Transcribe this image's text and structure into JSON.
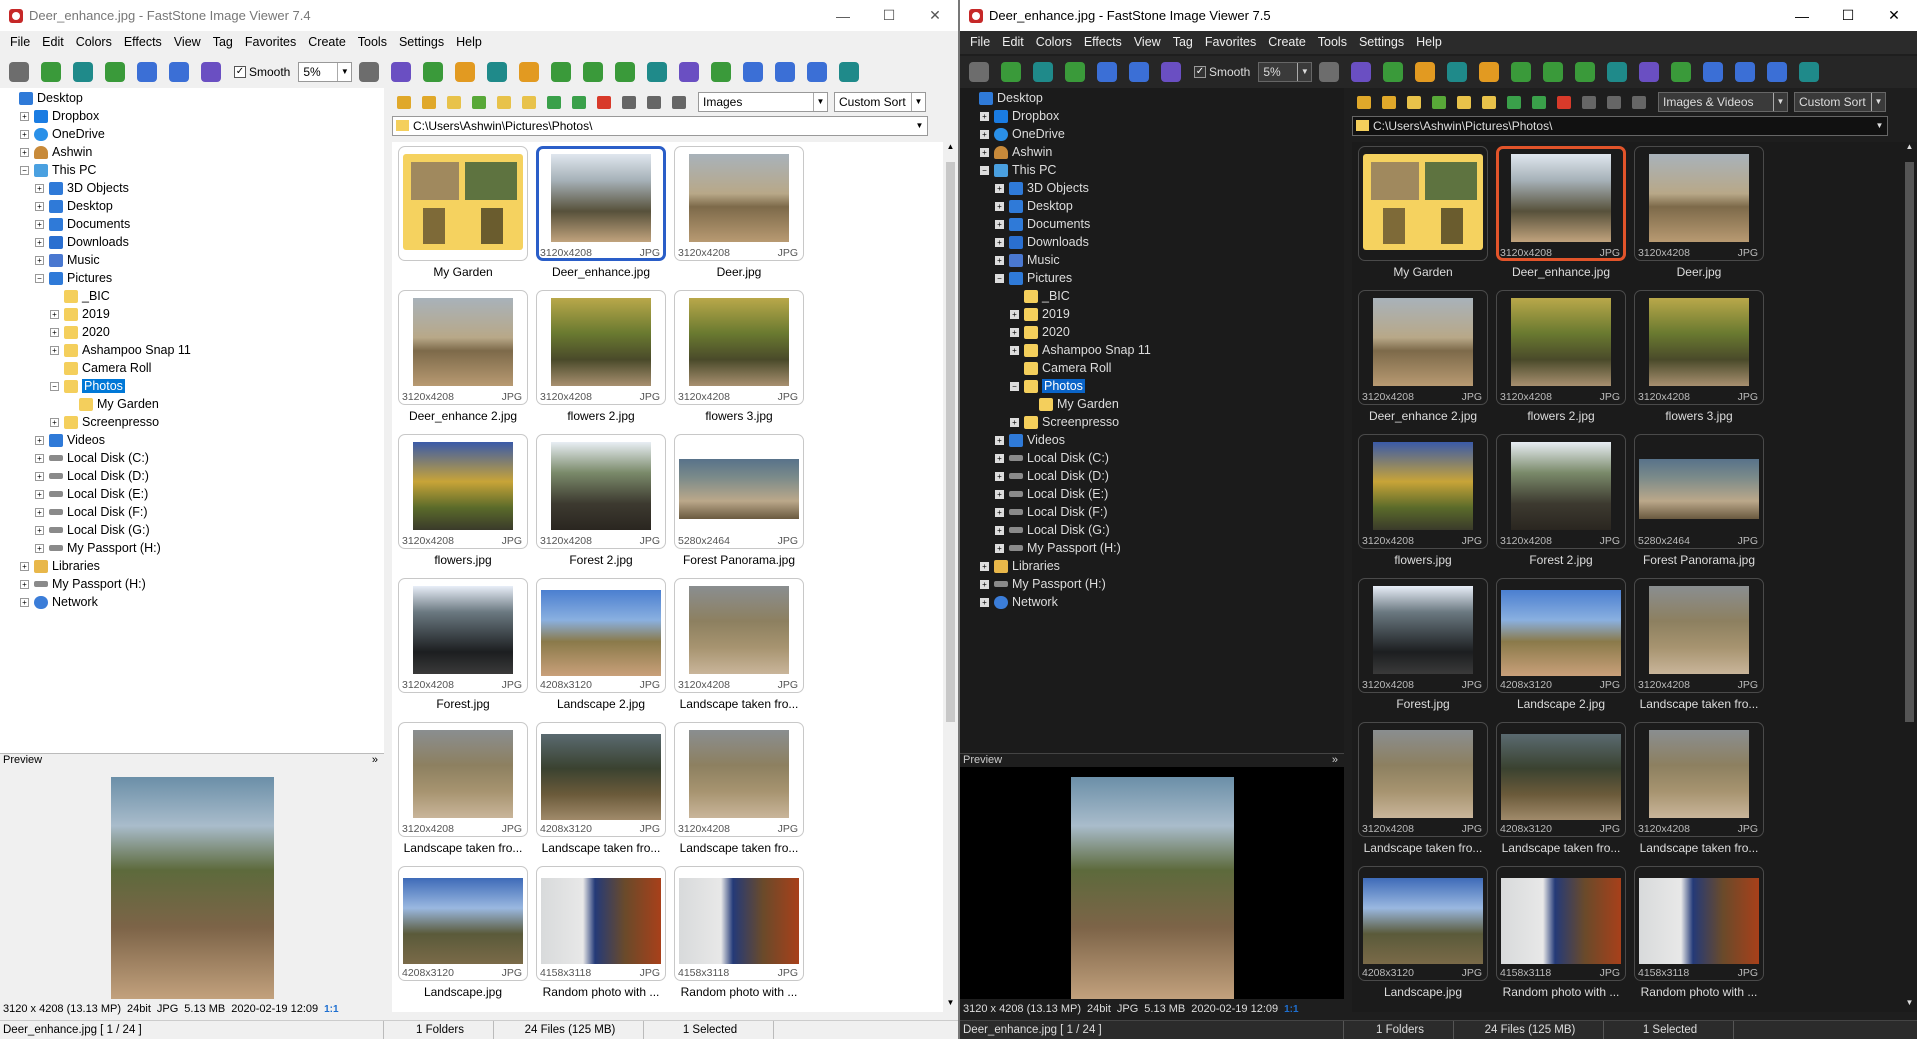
{
  "left": {
    "title": "Deer_enhance.jpg - FastStone Image Viewer 7.4",
    "menu": [
      "File",
      "Edit",
      "Colors",
      "Effects",
      "View",
      "Tag",
      "Favorites",
      "Create",
      "Tools",
      "Settings",
      "Help"
    ],
    "smooth_label": "Smooth",
    "zoom": "5%",
    "filter": "Images",
    "sort": "Custom Sort",
    "path": "C:\\Users\\Ashwin\\Pictures\\Photos\\",
    "preview_label": "Preview",
    "preview_info": {
      "dims": "3120 x 4208 (13.13 MP)",
      "bits": "24bit",
      "fmt": "JPG",
      "size": "5.13 MB",
      "date": "2020-02-19 12:09",
      "ratio": "1:1"
    },
    "status": {
      "file": "Deer_enhance.jpg [ 1 / 24 ]",
      "folders": "1 Folders",
      "files": "24 Files (125 MB)",
      "selected": "1 Selected"
    }
  },
  "right": {
    "title": "Deer_enhance.jpg - FastStone Image Viewer 7.5",
    "menu": [
      "File",
      "Edit",
      "Colors",
      "Effects",
      "View",
      "Tag",
      "Favorites",
      "Create",
      "Tools",
      "Settings",
      "Help"
    ],
    "smooth_label": "Smooth",
    "zoom": "5%",
    "filter": "Images & Videos",
    "sort": "Custom Sort",
    "path": "C:\\Users\\Ashwin\\Pictures\\Photos\\",
    "preview_label": "Preview",
    "preview_info": {
      "dims": "3120 x 4208 (13.13 MP)",
      "bits": "24bit",
      "fmt": "JPG",
      "size": "5.13 MB",
      "date": "2020-02-19 12:09",
      "ratio": "1:1"
    },
    "status": {
      "file": "Deer_enhance.jpg [ 1 / 24 ]",
      "folders": "1 Folders",
      "files": "24 Files (125 MB)",
      "selected": "1 Selected"
    }
  },
  "tree": [
    {
      "label": "Desktop",
      "icon": "blue",
      "level": 0,
      "exp": ""
    },
    {
      "label": "Dropbox",
      "icon": "dropbox",
      "level": 1,
      "exp": "+"
    },
    {
      "label": "OneDrive",
      "icon": "cloud",
      "level": 1,
      "exp": "+"
    },
    {
      "label": "Ashwin",
      "icon": "user",
      "level": 1,
      "exp": "+"
    },
    {
      "label": "This PC",
      "icon": "pc",
      "level": 1,
      "exp": "-"
    },
    {
      "label": "3D Objects",
      "icon": "blue",
      "level": 2,
      "exp": "+"
    },
    {
      "label": "Desktop",
      "icon": "blue",
      "level": 2,
      "exp": "+"
    },
    {
      "label": "Documents",
      "icon": "blue",
      "level": 2,
      "exp": "+"
    },
    {
      "label": "Downloads",
      "icon": "down",
      "level": 2,
      "exp": "+"
    },
    {
      "label": "Music",
      "icon": "music",
      "level": 2,
      "exp": "+"
    },
    {
      "label": "Pictures",
      "icon": "blue",
      "level": 2,
      "exp": "-"
    },
    {
      "label": "_BIC",
      "icon": "folder",
      "level": 3,
      "exp": ""
    },
    {
      "label": "2019",
      "icon": "folder",
      "level": 3,
      "exp": "+"
    },
    {
      "label": "2020",
      "icon": "folder",
      "level": 3,
      "exp": "+"
    },
    {
      "label": "Ashampoo Snap 11",
      "icon": "folder",
      "level": 3,
      "exp": "+"
    },
    {
      "label": "Camera Roll",
      "icon": "folder",
      "level": 3,
      "exp": ""
    },
    {
      "label": "Photos",
      "icon": "folder",
      "level": 3,
      "exp": "-",
      "selected": true
    },
    {
      "label": "My Garden",
      "icon": "folder",
      "level": 4,
      "exp": ""
    },
    {
      "label": "Screenpresso",
      "icon": "folder",
      "level": 3,
      "exp": "+"
    },
    {
      "label": "Videos",
      "icon": "blue",
      "level": 2,
      "exp": "+"
    },
    {
      "label": "Local Disk (C:)",
      "icon": "disk",
      "level": 2,
      "exp": "+"
    },
    {
      "label": "Local Disk (D:)",
      "icon": "disk",
      "level": 2,
      "exp": "+"
    },
    {
      "label": "Local Disk (E:)",
      "icon": "disk",
      "level": 2,
      "exp": "+"
    },
    {
      "label": "Local Disk (F:)",
      "icon": "disk",
      "level": 2,
      "exp": "+"
    },
    {
      "label": "Local Disk (G:)",
      "icon": "disk",
      "level": 2,
      "exp": "+"
    },
    {
      "label": "My Passport (H:)",
      "icon": "disk",
      "level": 2,
      "exp": "+"
    },
    {
      "label": "Libraries",
      "icon": "lib",
      "level": 1,
      "exp": "+"
    },
    {
      "label": "My Passport (H:)",
      "icon": "disk",
      "level": 1,
      "exp": "+"
    },
    {
      "label": "Network",
      "icon": "net",
      "level": 1,
      "exp": "+"
    }
  ],
  "thumbnails": [
    {
      "name": "My Garden",
      "type": "folder"
    },
    {
      "name": "Deer_enhance.jpg",
      "dims": "3120x4208",
      "fmt": "JPG",
      "tone": "t5",
      "orient": "portrait",
      "selected": true
    },
    {
      "name": "Deer.jpg",
      "dims": "3120x4208",
      "fmt": "JPG",
      "tone": "t1",
      "orient": "portrait"
    },
    {
      "name": "Deer_enhance 2.jpg",
      "dims": "3120x4208",
      "fmt": "JPG",
      "tone": "t1",
      "orient": "portrait"
    },
    {
      "name": "flowers 2.jpg",
      "dims": "3120x4208",
      "fmt": "JPG",
      "tone": "t2",
      "orient": "portrait"
    },
    {
      "name": "flowers 3.jpg",
      "dims": "3120x4208",
      "fmt": "JPG",
      "tone": "t2",
      "orient": "portrait"
    },
    {
      "name": "flowers.jpg",
      "dims": "3120x4208",
      "fmt": "JPG",
      "tone": "t3",
      "orient": "portrait"
    },
    {
      "name": "Forest 2.jpg",
      "dims": "3120x4208",
      "fmt": "JPG",
      "tone": "t4",
      "orient": "portrait"
    },
    {
      "name": "Forest Panorama.jpg",
      "dims": "5280x2464",
      "fmt": "JPG",
      "tone": "t9",
      "orient": "landscape"
    },
    {
      "name": "Forest.jpg",
      "dims": "3120x4208",
      "fmt": "JPG",
      "tone": "t6",
      "orient": "portrait"
    },
    {
      "name": "Landscape 2.jpg",
      "dims": "4208x3120",
      "fmt": "JPG",
      "tone": "t7",
      "orient": "wide"
    },
    {
      "name": "Landscape taken fro...",
      "dims": "3120x4208",
      "fmt": "JPG",
      "tone": "t8",
      "orient": "portrait"
    },
    {
      "name": "Landscape taken fro...",
      "dims": "3120x4208",
      "fmt": "JPG",
      "tone": "t8",
      "orient": "portrait"
    },
    {
      "name": "Landscape taken fro...",
      "dims": "4208x3120",
      "fmt": "JPG",
      "tone": "t10",
      "orient": "wide"
    },
    {
      "name": "Landscape taken fro...",
      "dims": "3120x4208",
      "fmt": "JPG",
      "tone": "t8",
      "orient": "portrait"
    },
    {
      "name": "Landscape.jpg",
      "dims": "4208x3120",
      "fmt": "JPG",
      "tone": "t11",
      "orient": "wide"
    },
    {
      "name": "Random photo with ...",
      "dims": "4158x3118",
      "fmt": "JPG",
      "tone": "t12",
      "orient": "wide"
    },
    {
      "name": "Random photo with ...",
      "dims": "4158x3118",
      "fmt": "JPG",
      "tone": "t12",
      "orient": "wide"
    }
  ],
  "toolbar_icons": [
    "open-icon",
    "folder-icon",
    "save-icon",
    "save-as-icon",
    "zoom-in-icon",
    "zoom-out-icon",
    "actual-size-icon"
  ],
  "toolbar_icons2": [
    "hand-icon",
    "slideshow-icon",
    "batch-icon",
    "crop-icon",
    "resize-icon",
    "adjust-icon",
    "color-icon",
    "rotate-left-icon",
    "rotate-right-icon",
    "compare-icon",
    "print-icon",
    "email-icon",
    "layout-1-icon",
    "layout-2-icon",
    "layout-3-icon",
    "fullscreen-icon"
  ],
  "colors": {
    "left_select": "#2a5ec8",
    "right_select": "#e2542a",
    "tree_select": "#0078d7"
  }
}
